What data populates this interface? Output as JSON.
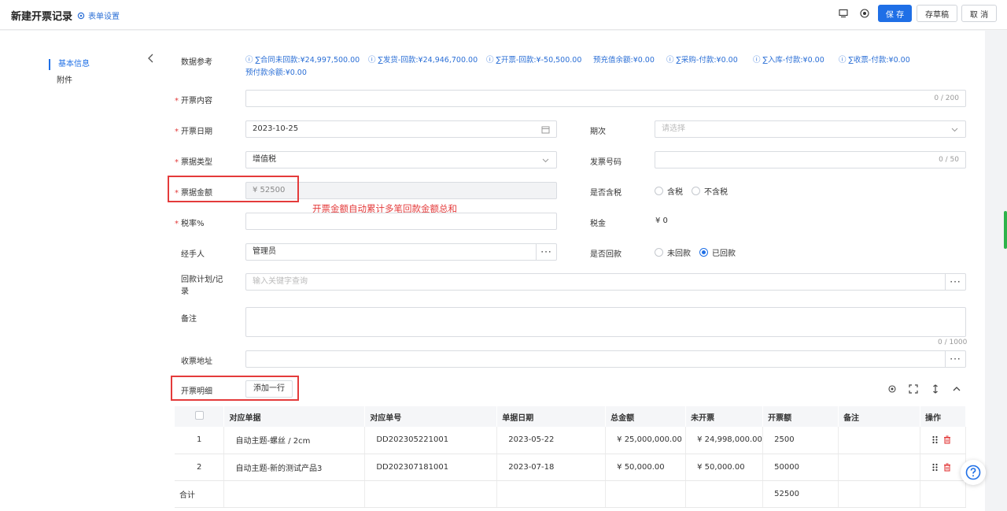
{
  "header": {
    "title": "新建开票记录",
    "form_settings": "表单设置",
    "save": "保 存",
    "draft": "存草稿",
    "cancel": "取 消"
  },
  "nav": {
    "items": [
      {
        "label": "基本信息",
        "active": true
      },
      {
        "label": "附件",
        "active": false
      }
    ]
  },
  "reference": {
    "label": "数据参考",
    "items": [
      "∑合同未回款:¥24,997,500.00",
      "∑发货-回款:¥24,946,700.00",
      "∑开票-回款:¥-50,500.00",
      "预充值余额:¥0.00",
      "∑采购-付款:¥0.00",
      "∑入库-付款:¥0.00",
      "∑收票-付款:¥0.00",
      "预付款余额:¥0.00"
    ]
  },
  "form": {
    "content": {
      "label": "开票内容",
      "counter": "0 / 200"
    },
    "date": {
      "label": "开票日期",
      "value": "2023-10-25"
    },
    "period": {
      "label": "期次",
      "placeholder": "请选择"
    },
    "type": {
      "label": "票据类型",
      "value": "增值税"
    },
    "invoice_no": {
      "label": "发票号码",
      "counter": "0 / 50"
    },
    "amount": {
      "label": "票据金额",
      "value": "¥ 52500"
    },
    "tax_included": {
      "label": "是否含税",
      "options": [
        "含税",
        "不含税"
      ],
      "selected": null
    },
    "tax_rate": {
      "label": "税率%"
    },
    "tax": {
      "label": "税金",
      "value": "¥ 0"
    },
    "handler": {
      "label": "经手人",
      "value": "管理员"
    },
    "returned": {
      "label": "是否回款",
      "options": [
        "未回款",
        "已回款"
      ],
      "selected": "已回款"
    },
    "plan": {
      "label_line1": "回款计划/记",
      "label_line2": "录",
      "placeholder": "输入关键字查询"
    },
    "remark": {
      "label": "备注",
      "counter": "0 / 1000"
    },
    "address": {
      "label": "收票地址"
    }
  },
  "annotation": "开票金额自动累计多笔回款金额总和",
  "details": {
    "label": "开票明细",
    "add_row": "添加一行",
    "columns": [
      "",
      "对应单据",
      "对应单号",
      "单据日期",
      "总金额",
      "未开票",
      "开票额",
      "备注",
      "操作"
    ],
    "rows": [
      {
        "idx": "1",
        "doc": "自动主题-螺丝 / 2cm",
        "no": "DD202305221001",
        "date": "2023-05-22",
        "total": "¥ 25,000,000.00",
        "unbilled": "¥ 24,998,000.00",
        "amount": "2500",
        "remark": ""
      },
      {
        "idx": "2",
        "doc": "自动主题-新的测试产品3",
        "no": "DD202307181001",
        "date": "2023-07-18",
        "total": "¥ 50,000.00",
        "unbilled": "¥ 50,000.00",
        "amount": "50000",
        "remark": ""
      }
    ],
    "summary": {
      "label": "合计",
      "amount": "52500"
    }
  },
  "colors": {
    "primary": "#1f6fe6",
    "link": "#2b6fd6",
    "required": "#e23a3a",
    "annotation": "#e43b3b",
    "delete": "#e23a3a"
  }
}
